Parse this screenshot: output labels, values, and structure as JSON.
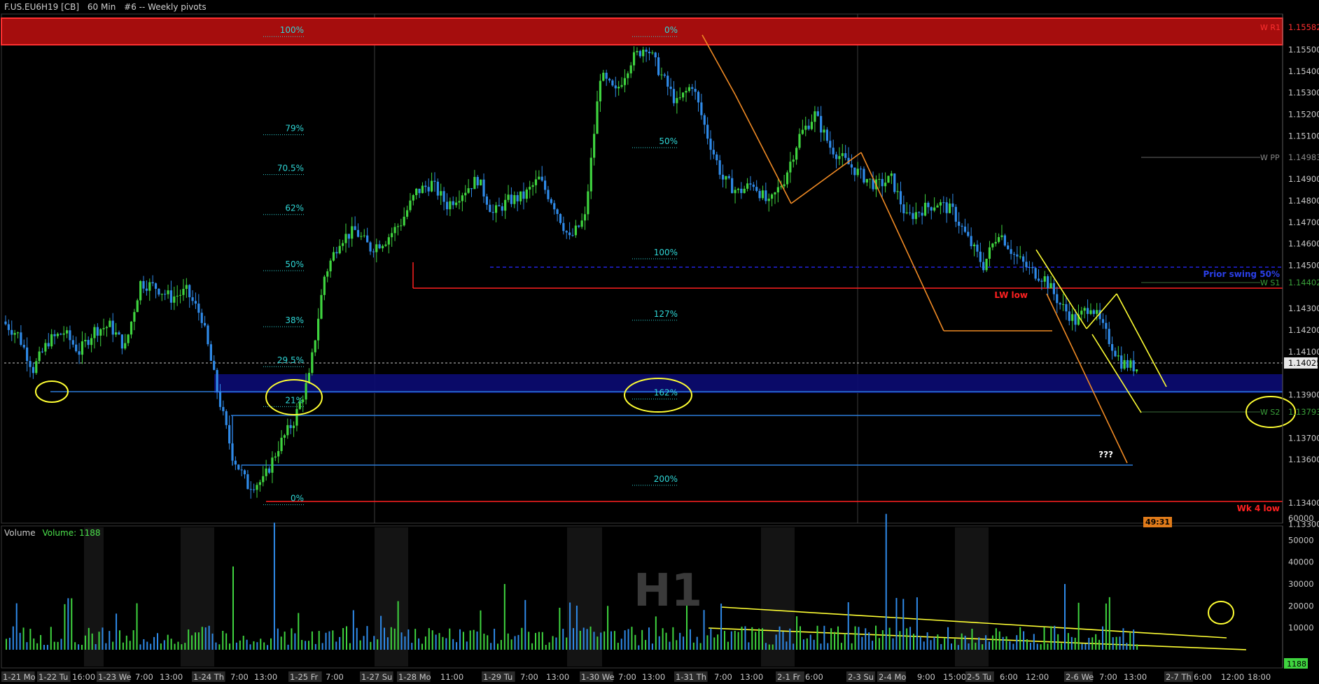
{
  "header": {
    "symbol": "F.US.EU6H19 [CB]",
    "interval": "60 Min",
    "study": "#6 -- Weekly pivots"
  },
  "volume_header": {
    "label": "Volume",
    "value_text": "Volume: 1188"
  },
  "timer": "49:31",
  "watermark": "H1",
  "colors": {
    "up": "#3fd43f",
    "down": "#2f8ae8",
    "fib": "#2fd7d7",
    "orange": "#f08a24",
    "yellow": "#ffff33",
    "red": "#ff2020",
    "navy": "#1a1aa8",
    "blueline": "#2a7bd8"
  },
  "chart_data": [
    {
      "type": "line",
      "title": "",
      "y_axis": {
        "range": [
          1.133,
          1.1562
        ],
        "ticks": [
          "1.15500",
          "1.15400",
          "1.15300",
          "1.15200",
          "1.15100",
          "1.14900",
          "1.14800",
          "1.14700",
          "1.14600",
          "1.14500",
          "1.14300",
          "1.14200",
          "1.14100",
          "1.13900",
          "1.13700",
          "1.13600",
          "1.13400",
          "1.13300"
        ],
        "tick_values": [
          1.155,
          1.154,
          1.153,
          1.152,
          1.151,
          1.149,
          1.148,
          1.147,
          1.146,
          1.145,
          1.143,
          1.142,
          1.141,
          1.139,
          1.137,
          1.136,
          1.134,
          1.133
        ]
      },
      "last_price": {
        "label": "1.14025",
        "value": 1.14025
      },
      "pivots": [
        {
          "label": "W R1",
          "price_label": "1.15582",
          "value": 1.15582
        },
        {
          "label": "W PP",
          "price_label": "1.14983",
          "value": 1.14983
        },
        {
          "label": "W S1",
          "price_label": "1.14402",
          "value": 1.14402
        },
        {
          "label": "W S2",
          "price_label": "1.13793",
          "value": 1.13793
        }
      ],
      "annotations": [
        "Prior swing 50%",
        "LW low",
        "Wk 4 low",
        "???"
      ],
      "fib_left": [
        {
          "label": "100%",
          "value": 1.1559
        },
        {
          "label": "79%",
          "value": 1.15135
        },
        {
          "label": "70.5%",
          "value": 1.1495
        },
        {
          "label": "62%",
          "value": 1.14765
        },
        {
          "label": "50%",
          "value": 1.14505
        },
        {
          "label": "38%",
          "value": 1.14245
        },
        {
          "label": "29.5%",
          "value": 1.1406
        },
        {
          "label": "21%",
          "value": 1.13875
        },
        {
          "label": "0%",
          "value": 1.1342
        }
      ],
      "fib_mid": [
        {
          "label": "0%",
          "value": 1.1559
        },
        {
          "label": "50%",
          "value": 1.15075
        },
        {
          "label": "100%",
          "value": 1.1456
        },
        {
          "label": "127%",
          "value": 1.14275
        },
        {
          "label": "162%",
          "value": 1.1391
        },
        {
          "label": "200%",
          "value": 1.1351
        }
      ],
      "price_path": [
        {
          "d": "1-21",
          "v": 1.1424
        },
        {
          "d": "1-21",
          "v": 1.1418
        },
        {
          "d": "1-22",
          "v": 1.1402
        },
        {
          "d": "1-22",
          "v": 1.1415
        },
        {
          "d": "1-22",
          "v": 1.1419
        },
        {
          "d": "1-23",
          "v": 1.141
        },
        {
          "d": "1-23",
          "v": 1.142
        },
        {
          "d": "1-23",
          "v": 1.1422
        },
        {
          "d": "1-24",
          "v": 1.1412
        },
        {
          "d": "1-24",
          "v": 1.1442
        },
        {
          "d": "1-24",
          "v": 1.144
        },
        {
          "d": "1-24",
          "v": 1.1435
        },
        {
          "d": "1-24",
          "v": 1.1438
        },
        {
          "d": "1-24",
          "v": 1.1426
        },
        {
          "d": "1-25",
          "v": 1.1392
        },
        {
          "d": "1-25",
          "v": 1.1362
        },
        {
          "d": "1-25",
          "v": 1.1348
        },
        {
          "d": "1-25",
          "v": 1.135
        },
        {
          "d": "1-25",
          "v": 1.1366
        },
        {
          "d": "1-25",
          "v": 1.1378
        },
        {
          "d": "1-25",
          "v": 1.1398
        },
        {
          "d": "1-27",
          "v": 1.1445
        },
        {
          "d": "1-27",
          "v": 1.1462
        },
        {
          "d": "1-27",
          "v": 1.1466
        },
        {
          "d": "1-28",
          "v": 1.1458
        },
        {
          "d": "1-28",
          "v": 1.1462
        },
        {
          "d": "1-28",
          "v": 1.147
        },
        {
          "d": "1-28",
          "v": 1.1484
        },
        {
          "d": "1-28",
          "v": 1.1488
        },
        {
          "d": "1-29",
          "v": 1.1478
        },
        {
          "d": "1-29",
          "v": 1.1484
        },
        {
          "d": "1-29",
          "v": 1.149
        },
        {
          "d": "1-29",
          "v": 1.1474
        },
        {
          "d": "1-29",
          "v": 1.148
        },
        {
          "d": "1-30",
          "v": 1.1482
        },
        {
          "d": "1-30",
          "v": 1.149
        },
        {
          "d": "1-30",
          "v": 1.1478
        },
        {
          "d": "1-30",
          "v": 1.1462
        },
        {
          "d": "1-30",
          "v": 1.1472
        },
        {
          "d": "1-30",
          "v": 1.1538
        },
        {
          "d": "1-30",
          "v": 1.153
        },
        {
          "d": "1-30",
          "v": 1.1545
        },
        {
          "d": "1-31",
          "v": 1.1552
        },
        {
          "d": "1-31",
          "v": 1.1538
        },
        {
          "d": "1-31",
          "v": 1.1525
        },
        {
          "d": "1-31",
          "v": 1.1534
        },
        {
          "d": "1-31",
          "v": 1.151
        },
        {
          "d": "1-31",
          "v": 1.149
        },
        {
          "d": "2-1",
          "v": 1.1484
        },
        {
          "d": "2-1",
          "v": 1.1488
        },
        {
          "d": "2-1",
          "v": 1.1478
        },
        {
          "d": "2-1",
          "v": 1.149
        },
        {
          "d": "2-1",
          "v": 1.151
        },
        {
          "d": "2-1",
          "v": 1.152
        },
        {
          "d": "2-1",
          "v": 1.1505
        },
        {
          "d": "2-3",
          "v": 1.1498
        },
        {
          "d": "2-3",
          "v": 1.1492
        },
        {
          "d": "2-4",
          "v": 1.1487
        },
        {
          "d": "2-4",
          "v": 1.149
        },
        {
          "d": "2-4",
          "v": 1.1472
        },
        {
          "d": "2-4",
          "v": 1.1476
        },
        {
          "d": "2-4",
          "v": 1.1479
        },
        {
          "d": "2-5",
          "v": 1.1475
        },
        {
          "d": "2-5",
          "v": 1.1462
        },
        {
          "d": "2-5",
          "v": 1.145
        },
        {
          "d": "2-5",
          "v": 1.1466
        },
        {
          "d": "2-5",
          "v": 1.1455
        },
        {
          "d": "2-6",
          "v": 1.1448
        },
        {
          "d": "2-6",
          "v": 1.1444
        },
        {
          "d": "2-6",
          "v": 1.1432
        },
        {
          "d": "2-6",
          "v": 1.1424
        },
        {
          "d": "2-6",
          "v": 1.1432
        },
        {
          "d": "2-6",
          "v": 1.1418
        },
        {
          "d": "2-6",
          "v": 1.1405
        },
        {
          "d": "2-6",
          "v": 1.14025
        }
      ],
      "volume": {
        "ticks": [
          "60000",
          "50000",
          "40000",
          "30000",
          "20000",
          "10000"
        ],
        "tick_values": [
          60000,
          50000,
          40000,
          30000,
          20000,
          10000
        ],
        "range": [
          0,
          66000
        ],
        "last_label": "1188"
      },
      "x_labels": [
        "1-21 Mo",
        "1-22 Tu",
        "16:00",
        "1-23 We",
        "7:00",
        "13:00",
        "1-24 Th",
        "7:00",
        "13:00",
        "1-25 Fr",
        "7:00",
        "1-27 Su",
        "1-28 Mo",
        "11:00",
        "1-29 Tu",
        "7:00",
        "13:00",
        "1-30 We",
        "7:00",
        "13:00",
        "1-31 Th",
        "7:00",
        "13:00",
        "2-1 Fr",
        "6:00",
        "2-3 Su",
        "2-4 Mo",
        "9:00",
        "15:00",
        "2-5 Tu",
        "6:00",
        "12:00",
        "2-6 We",
        "7:00",
        "13:00",
        "2-7 Th",
        "6:00",
        "12:00",
        "18:00"
      ]
    }
  ]
}
